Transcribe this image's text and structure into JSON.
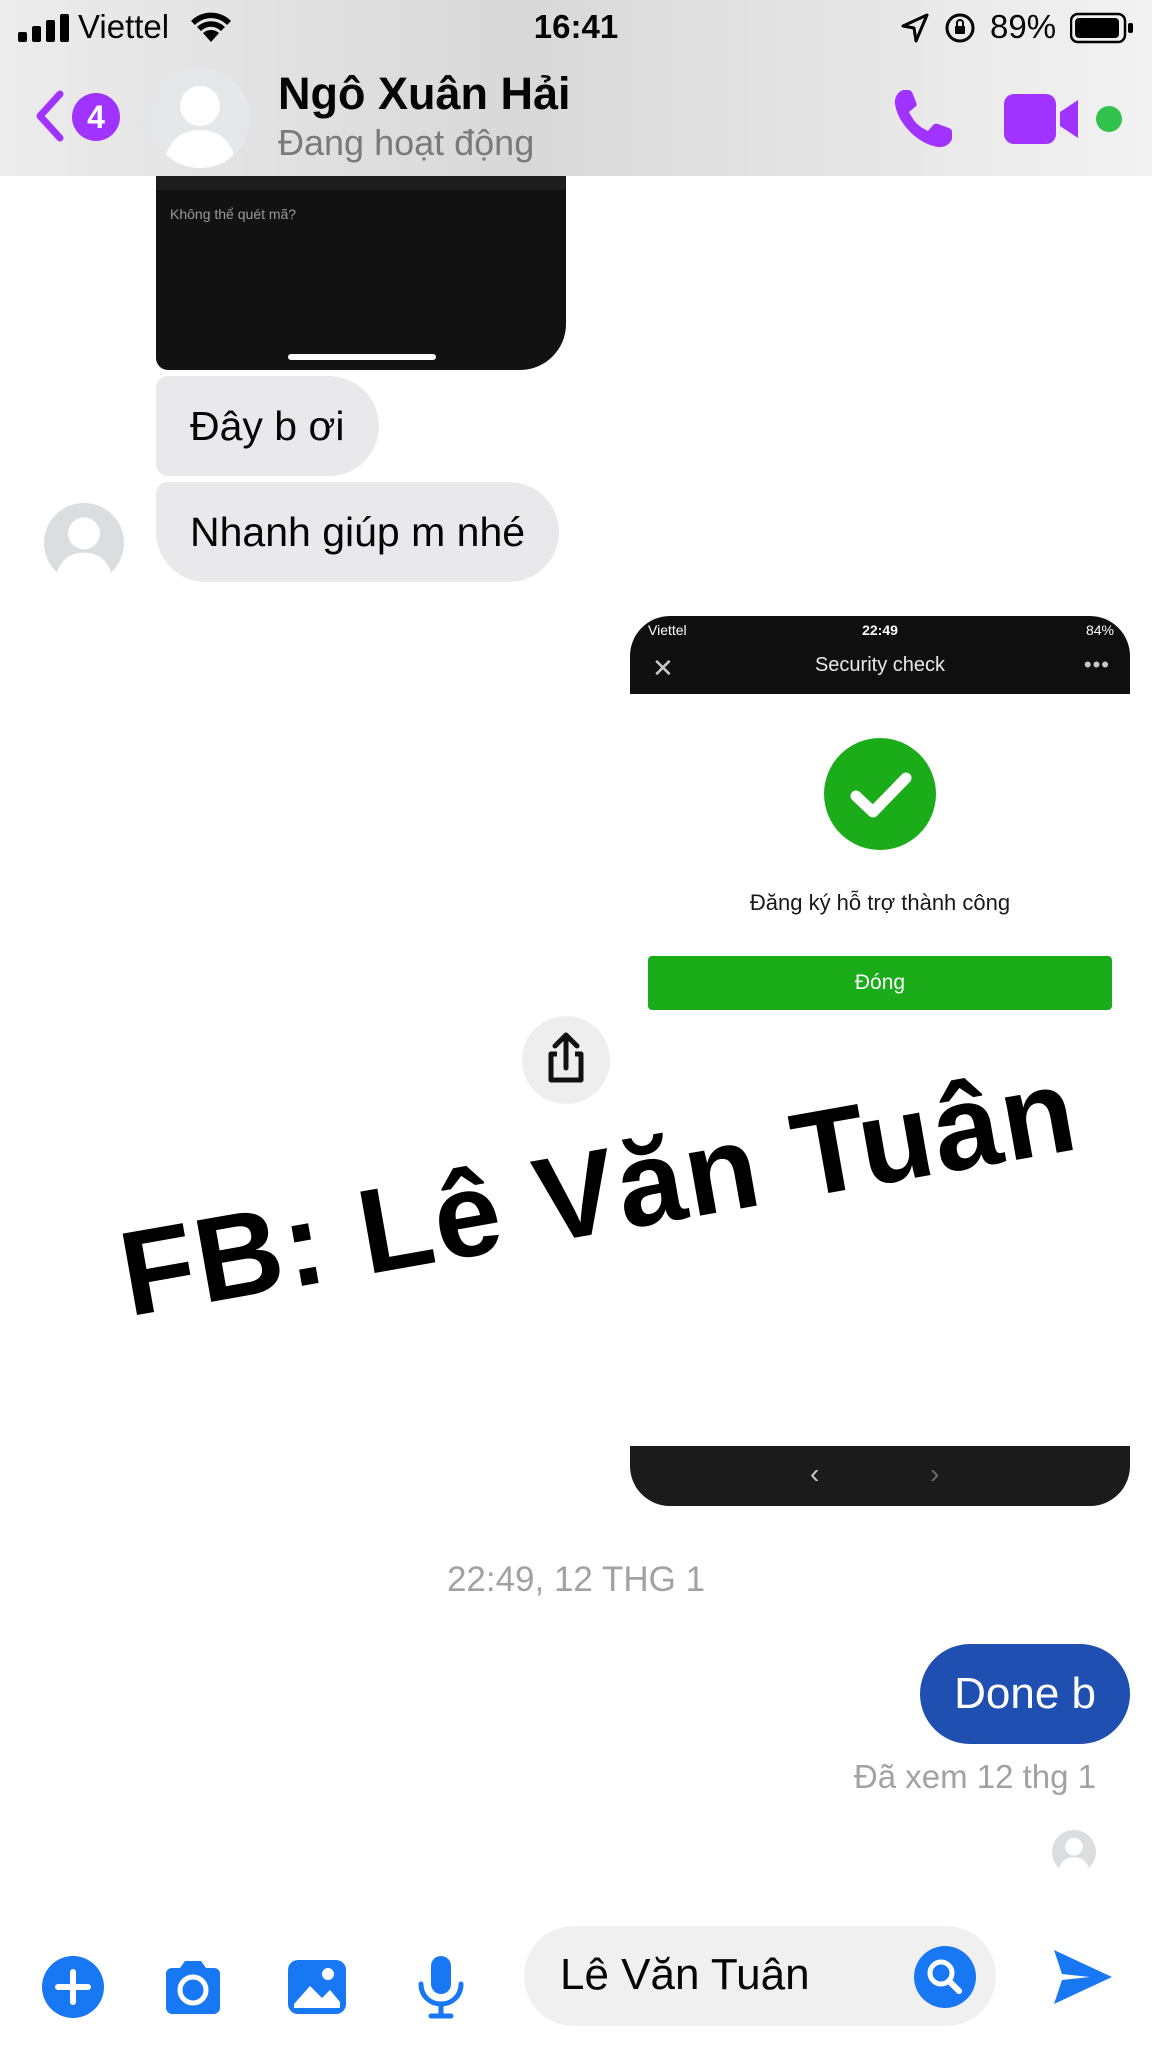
{
  "status_bar": {
    "carrier": "Viettel",
    "time": "16:41",
    "battery_percent": "89%"
  },
  "header": {
    "back_badge": "4",
    "contact_name": "Ngô Xuân Hải",
    "presence": "Đang hoạt động",
    "accent_color": "#a033ff",
    "online_color": "#31c24d"
  },
  "messages": {
    "prev_image_caption": "Không thể quét mã?",
    "incoming": [
      "Đây b ơi",
      "Nhanh giúp m nhé"
    ],
    "screenshot": {
      "carrier": "Viettel",
      "time": "22:49",
      "battery": "84%",
      "title": "Security check",
      "message": "Đăng ký hỗ trợ thành công",
      "button": "Đóng",
      "accent_color": "#1aad19"
    },
    "watermark": "FB: Lê Văn Tuân",
    "timestamp": "22:49, 12 THG 1",
    "outgoing": "Done b",
    "seen_text": "Đã xem 12 thg 1",
    "outgoing_color": "#1f4fb0"
  },
  "composer": {
    "input_value": "Lê Văn Tuân",
    "icon_color": "#1877f2"
  }
}
